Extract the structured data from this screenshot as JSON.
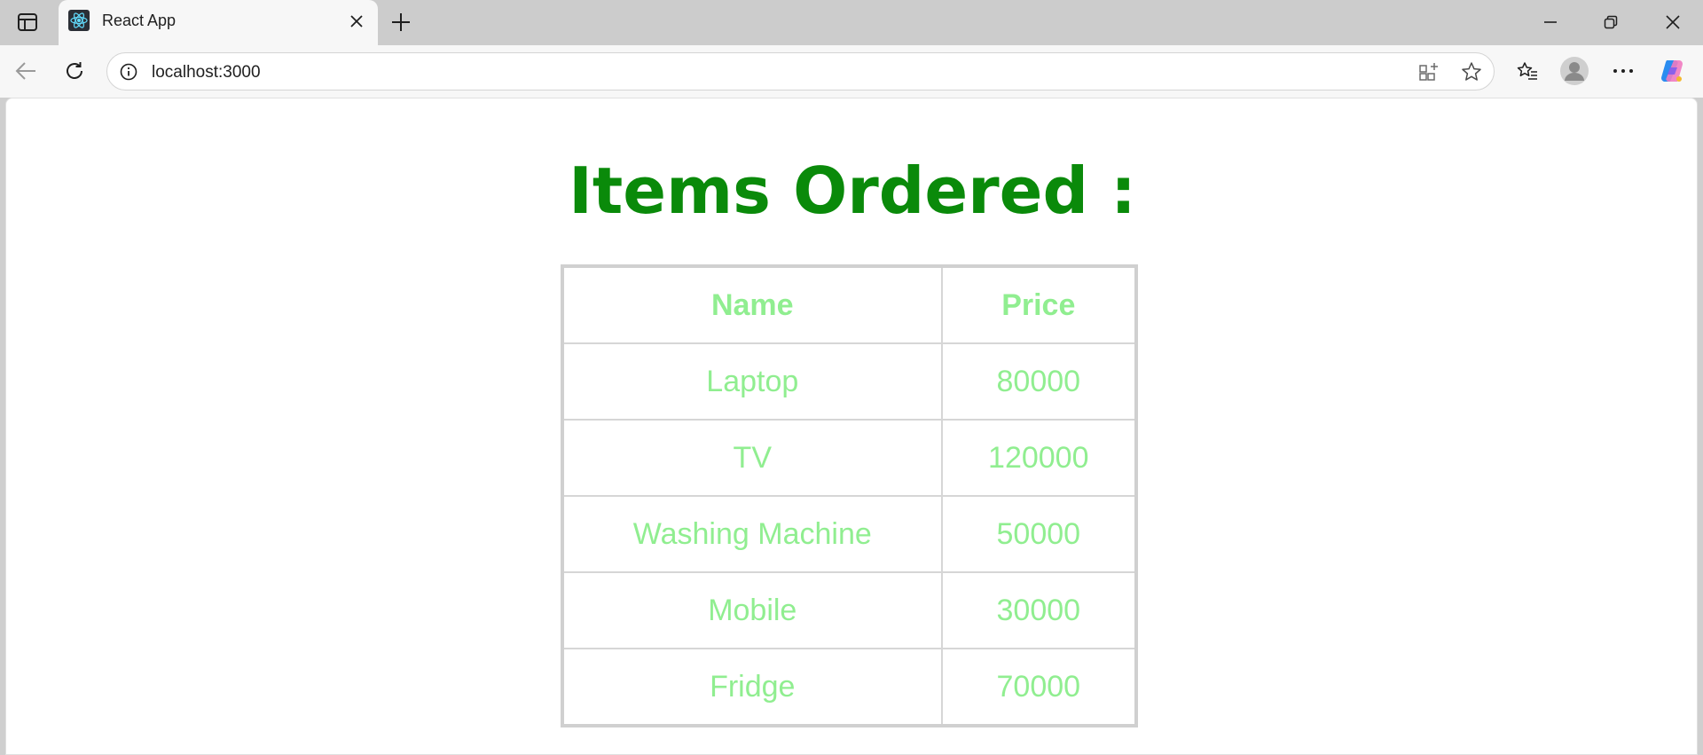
{
  "browser": {
    "tab": {
      "title": "React App"
    },
    "address": {
      "url": "localhost:3000"
    },
    "icons": {
      "tab_actions": "tab-actions-icon",
      "favicon": "react-logo-icon",
      "tab_close": "close-icon",
      "new_tab": "plus-icon",
      "minimize": "minimize-icon",
      "restore": "restore-icon",
      "close_window": "close-icon",
      "back": "back-arrow-icon",
      "refresh": "refresh-icon",
      "info": "info-icon",
      "apps": "apps-icon",
      "favorite": "star-icon",
      "favorites": "favorites-icon",
      "profile": "profile-avatar-icon",
      "more": "more-icon",
      "copilot": "copilot-icon"
    }
  },
  "page": {
    "heading": "Items Ordered :",
    "table": {
      "headers": [
        "Name",
        "Price"
      ],
      "rows": [
        [
          "Laptop",
          "80000"
        ],
        [
          "TV",
          "120000"
        ],
        [
          "Washing Machine",
          "50000"
        ],
        [
          "Mobile",
          "30000"
        ],
        [
          "Fridge",
          "70000"
        ]
      ]
    },
    "colors": {
      "heading": "#0a8a0a",
      "table_text": "#90ee90",
      "table_border": "#d0d0d0"
    }
  }
}
